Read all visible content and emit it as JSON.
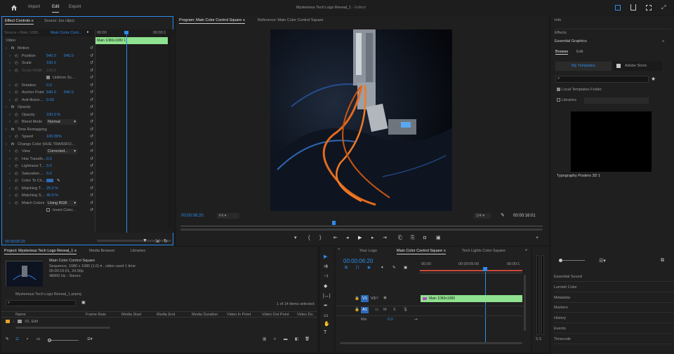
{
  "menubar": {
    "tabs": [
      "Import",
      "Edit",
      "Export"
    ],
    "title": "Mysterious Tech Logo Reveal_1",
    "status": "- Edited"
  },
  "effect_controls": {
    "tab": "Effect Controls",
    "tab_menu": "≡",
    "source_tab": "Source: (no clips)",
    "source_sel": "Source • Main 1080...",
    "clip_sel": "Main Color Cont...",
    "ruler_start": "00:00",
    "ruler_end": "00:00:1",
    "clip_name": "Main 1080x1080 1",
    "timecode": "00:00:06:20",
    "video_label": "Video",
    "rows": [
      {
        "label": "Motion",
        "fx": true
      },
      {
        "label": "Position",
        "v1": "540.0",
        "v2": "540.0"
      },
      {
        "label": "Scale",
        "v1": "100.0"
      },
      {
        "label": "Scale Width",
        "v1": "100.0",
        "dim": true
      },
      {
        "label": "Uniform Sc...",
        "checkbox": true
      },
      {
        "label": "Rotation",
        "v1": "0.0"
      },
      {
        "label": "Anchor Point",
        "v1": "540.0",
        "v2": "540.0"
      },
      {
        "label": "Anti-flicker...",
        "v1": "0.00"
      },
      {
        "label": "Opacity",
        "fx": true
      },
      {
        "label": "Opacity",
        "v1": "100.0 %"
      },
      {
        "label": "Blend Mode",
        "select": "Normal"
      },
      {
        "label": "Time Remapping",
        "fx": true
      },
      {
        "label": "Speed",
        "v1": "100.00%"
      },
      {
        "label": "Change Color (HUE TRANSFO...",
        "fx": true
      },
      {
        "label": "View",
        "select": "Corrected..."
      },
      {
        "label": "Hue Transfo...",
        "v1": "0.0"
      },
      {
        "label": "Lightness T...",
        "v1": "0.0"
      },
      {
        "label": "Saturation ...",
        "v1": "0.0"
      },
      {
        "label": "Color To Ch..."
      },
      {
        "label": "Matching T...",
        "v1": "25.0 %"
      },
      {
        "label": "Matching S...",
        "v1": "40.0 %"
      },
      {
        "label": "Match Colors",
        "select": "Using RGB"
      },
      {
        "label": "Invert Color...",
        "checkbox": true
      }
    ]
  },
  "program": {
    "tab": "Program: Main Color Control Square",
    "tab_menu": "≡",
    "reference_tab": "Reference: Main Color Control Square",
    "timecode": "00:00:06:20",
    "fit": "Fit",
    "resolution": "1/4",
    "duration": "00:00:16:01"
  },
  "right_panel": {
    "info": "Info",
    "effects": "Effects",
    "essential_graphics": "Essential Graphics",
    "eg_menu": "≡",
    "tabs": [
      "Browse",
      "Edit"
    ],
    "my_templates": "My Templates",
    "adobe_stock": "Adobe Stock",
    "local_templates": "Local Templates Folder",
    "libraries": "Libraries",
    "template_name": "Typography Posters 3D 1",
    "list": [
      "Essential Sound",
      "Lumetri Color",
      "Metadata",
      "Markers",
      "History",
      "Events",
      "Timecode"
    ]
  },
  "project": {
    "tab": "Project: Mysterious Tech Logo Reveal_1",
    "tab_menu": "≡",
    "tabs": [
      "Media Browser",
      "Libraries"
    ],
    "clip_name": "Main Color Control Square",
    "clip_info": [
      "Sequence, 1080 x 1080 (1.0) ▾ , video used 1 time",
      "00:00:16:01, 24.00p",
      "48000 Hz - Stereo"
    ],
    "file": "Mysterious Tech Logo Reveal_1.prproj",
    "selection": "1 of 14 items selected",
    "columns": [
      "Name",
      "Frame Rate",
      "Media Start",
      "Media End",
      "Media Duration",
      "Video In Point",
      "Video Out Point",
      "Video Du"
    ],
    "row": "01. Edit"
  },
  "timeline": {
    "tabs": [
      "Your Logo",
      "Main Color Control Square",
      "Tech Lights Color Square"
    ],
    "tab_menu": "≡",
    "timecode": "00:00:06:20",
    "ruler": [
      "00:00",
      "00:00:05:00",
      "00:00:1"
    ],
    "tracks": [
      {
        "name": "V1",
        "src": "V1"
      },
      {
        "name": "A1",
        "src": "A1",
        "m": "M",
        "s": "S"
      },
      {
        "name": "Mix",
        "value": "0.0"
      }
    ],
    "clip": "Main 1080x1080",
    "meter": "S  S"
  },
  "colors": {
    "accent": "#2d8ceb",
    "clip_green": "#8fe28f",
    "panel": "#232323"
  }
}
